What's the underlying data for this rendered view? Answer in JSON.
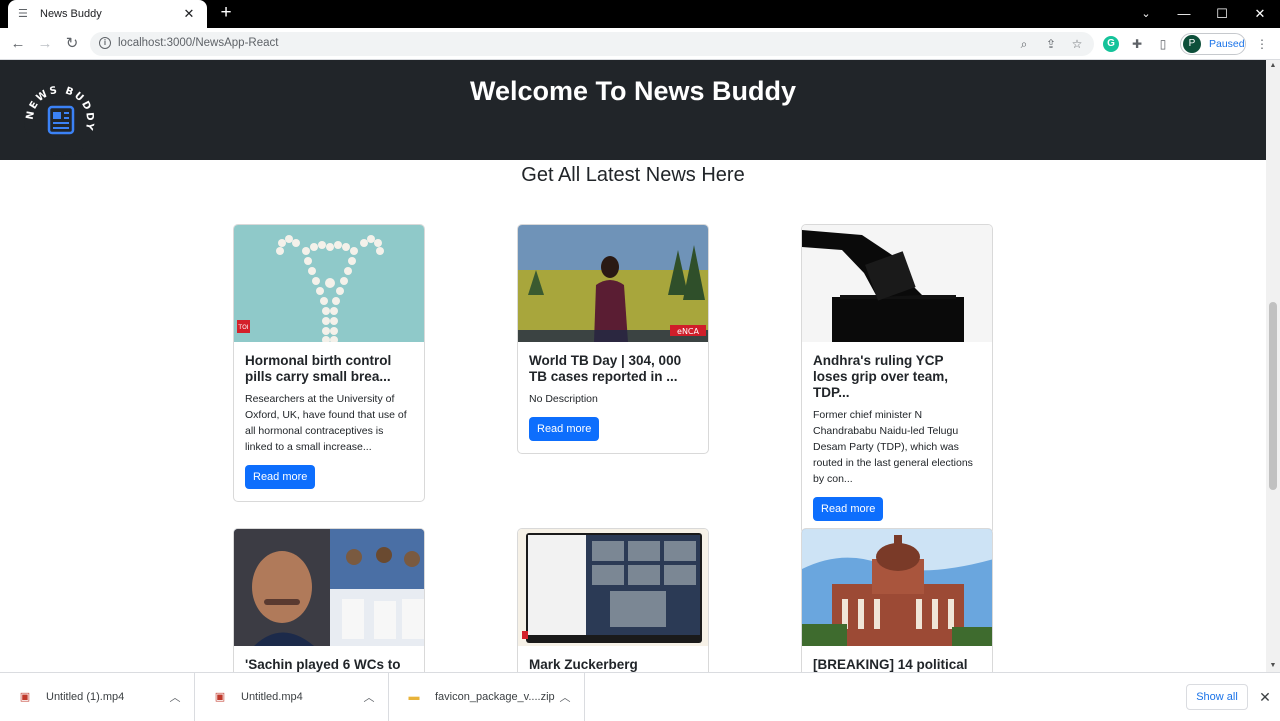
{
  "browser": {
    "tab_title": "News Buddy",
    "url": "localhost:3000/NewsApp-React",
    "profile_initial": "P",
    "profile_status": "Paused"
  },
  "header": {
    "title": "Welcome To News Buddy",
    "logo_text": "NEWS BUDDY"
  },
  "subtitle": "Get All Latest News Here",
  "cards": [
    {
      "title": "Hormonal birth control pills carry small brea...",
      "description": "Researchers at the University of Oxford, UK, have found that use of all hormonal contraceptives is linked to a small increase...",
      "button": "Read more",
      "image_badge": "TOI"
    },
    {
      "title": "World TB Day | 304, 000 TB cases reported in ...",
      "description": "No Description",
      "button": "Read more",
      "image_badge": "eNCA"
    },
    {
      "title": "Andhra's ruling YCP loses grip over team, TDP...",
      "description": "Former chief minister N Chandrababu Naidu-led Telugu Desam Party (TDP), which was routed in the last general elections by con...",
      "button": "Read more",
      "image_badge": ""
    },
    {
      "title": "'Sachin played 6 WCs to",
      "description": "",
      "button": "",
      "image_badge": ""
    },
    {
      "title": "Mark Zuckerberg",
      "description": "",
      "button": "",
      "image_badge": ""
    },
    {
      "title": "[BREAKING] 14 political",
      "description": "",
      "button": "",
      "image_badge": ""
    }
  ],
  "downloads": [
    {
      "name": "Untitled (1).mp4",
      "icon": "video-file-icon"
    },
    {
      "name": "Untitled.mp4",
      "icon": "video-file-icon"
    },
    {
      "name": "favicon_package_v....zip",
      "icon": "zip-folder-icon"
    }
  ],
  "shelf": {
    "show_all": "Show all"
  },
  "colors": {
    "header_bg": "#212529",
    "button": "#0d6efd"
  }
}
